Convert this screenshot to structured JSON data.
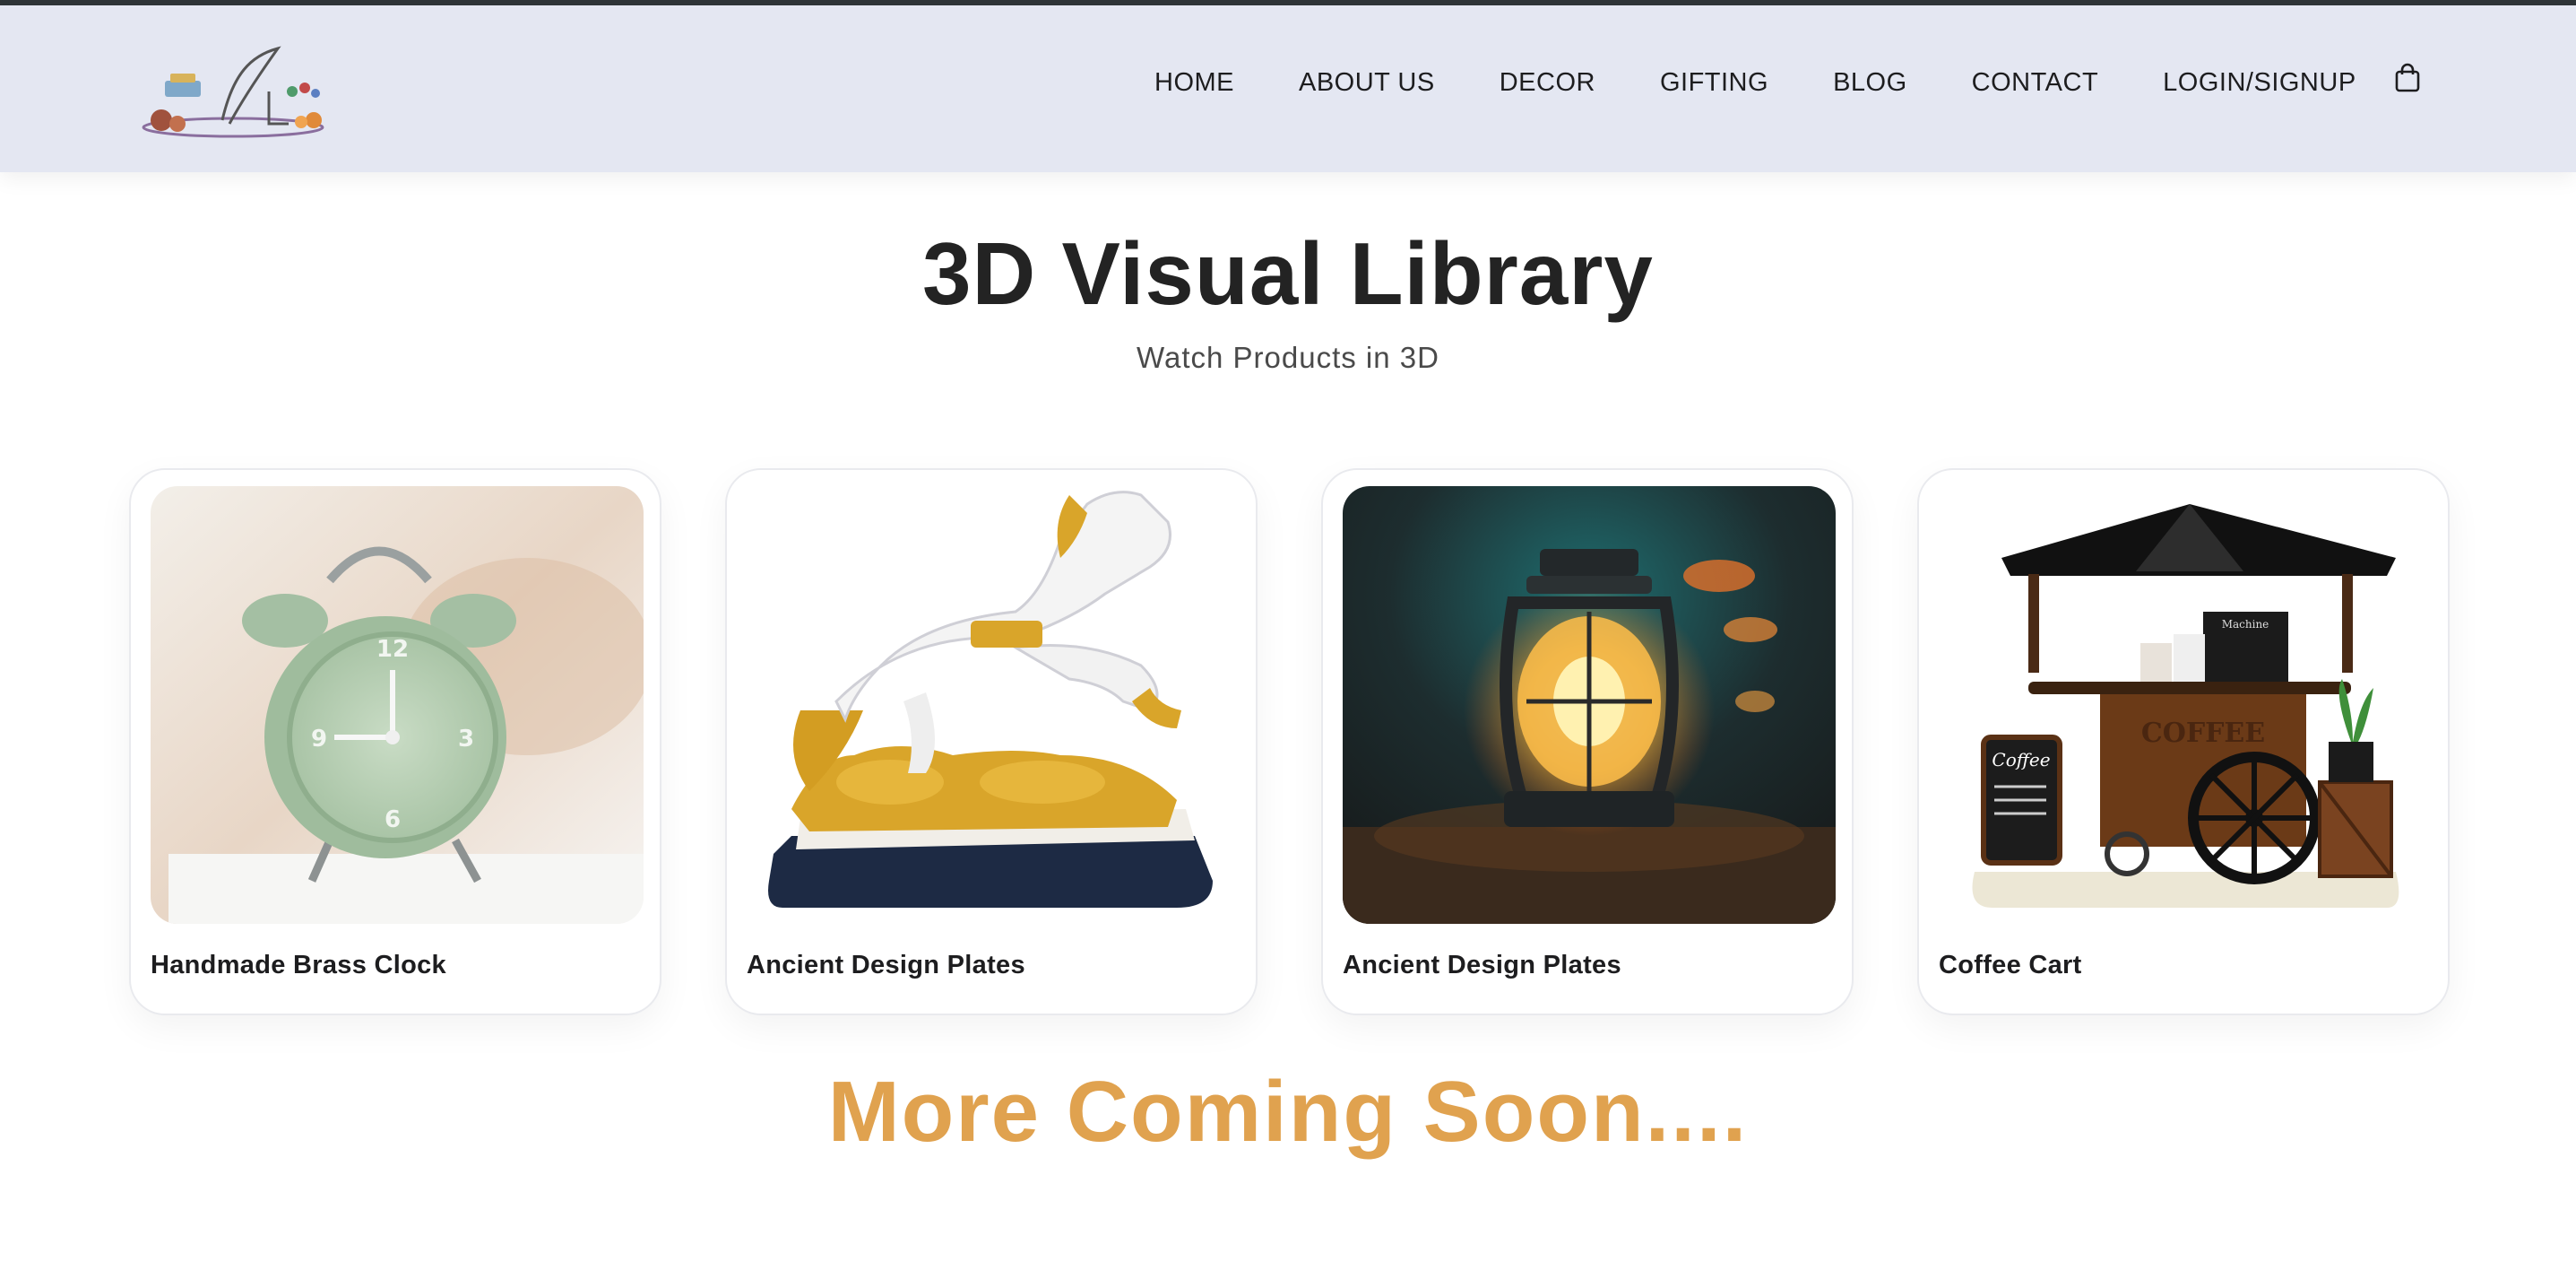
{
  "nav": {
    "items": [
      {
        "label": "HOME"
      },
      {
        "label": "ABOUT US"
      },
      {
        "label": "DECOR"
      },
      {
        "label": "GIFTING"
      },
      {
        "label": "BLOG"
      },
      {
        "label": "CONTACT"
      },
      {
        "label": "LOGIN/SIGNUP"
      }
    ],
    "cart_icon": "shopping-bag-icon",
    "logo_icon": "brand-logo-icon"
  },
  "hero": {
    "title": "3D Visual Library",
    "subtitle": "Watch Products in 3D"
  },
  "products": [
    {
      "name": "Handmade Brass Clock",
      "image": "alarm-clock-image"
    },
    {
      "name": "Ancient Design Plates",
      "image": "horse-statue-image"
    },
    {
      "name": "Ancient Design Plates",
      "image": "lantern-image"
    },
    {
      "name": "Coffee Cart",
      "image": "coffee-cart-image"
    }
  ],
  "product_image_text": {
    "cart_sign": "COFFEE",
    "board_text": "Coffee",
    "machine_text": "Machine"
  },
  "footer": {
    "coming_soon": "More Coming Soon...."
  },
  "colors": {
    "nav_bg": "#e4e7f2",
    "accent": "#e0a24f",
    "text": "#1d1d1f"
  }
}
